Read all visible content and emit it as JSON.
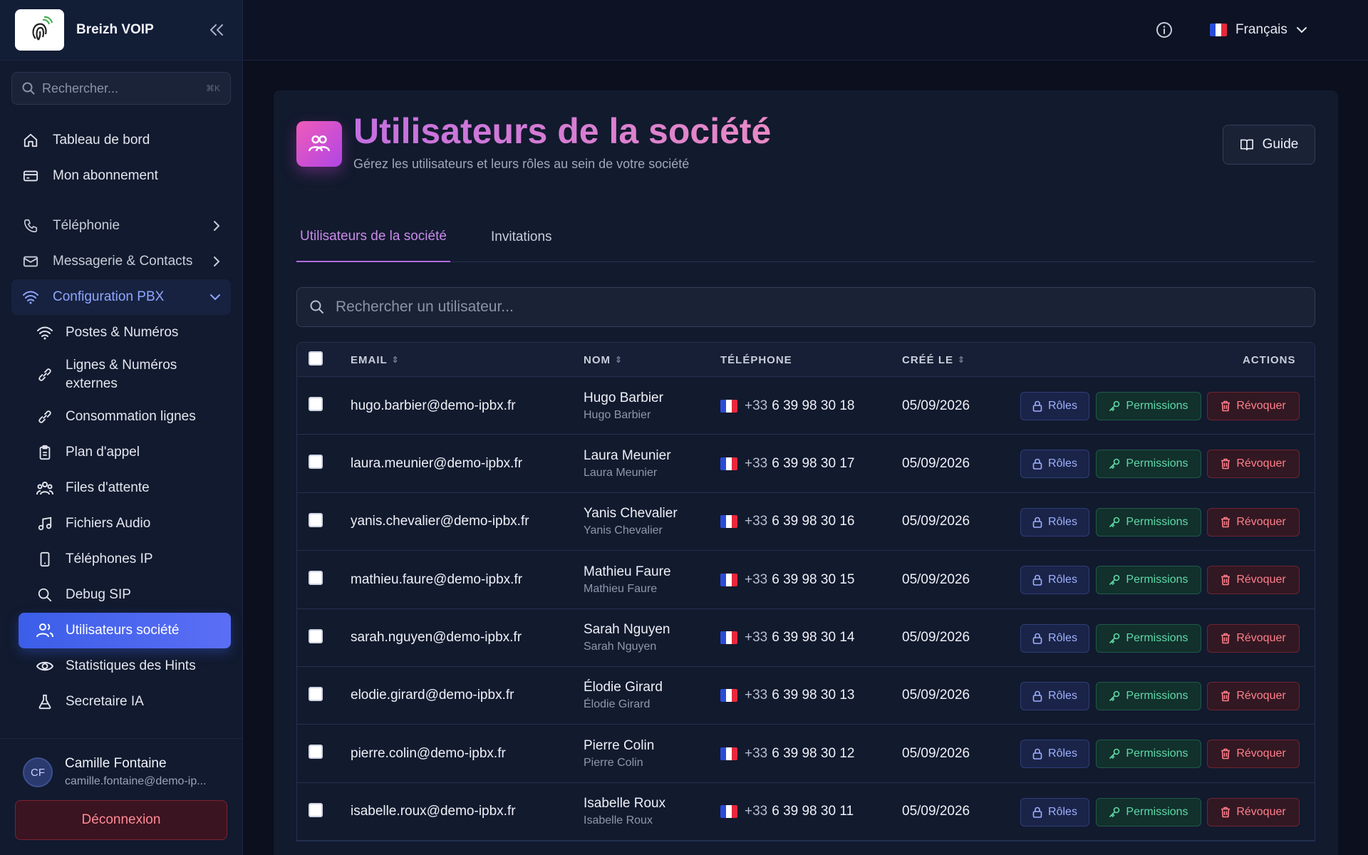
{
  "brand": {
    "name": "Breizh VOIP"
  },
  "sidebar": {
    "search_placeholder": "Rechercher...",
    "search_shortcut": "⌘K",
    "items": [
      {
        "label": "Tableau de bord",
        "icon": "home-icon"
      },
      {
        "label": "Mon abonnement",
        "icon": "credit-card-icon"
      },
      {
        "label": "Téléphonie",
        "icon": "phone-icon"
      },
      {
        "label": "Messagerie & Contacts",
        "icon": "mail-icon"
      },
      {
        "label": "Configuration PBX",
        "icon": "wifi-icon"
      }
    ],
    "sub_items": [
      {
        "label": "Postes & Numéros",
        "icon": "wifi-icon"
      },
      {
        "label": "Lignes & Numéros externes",
        "icon": "link-icon"
      },
      {
        "label": "Consommation lignes",
        "icon": "link-icon"
      },
      {
        "label": "Plan d'appel",
        "icon": "clipboard-icon"
      },
      {
        "label": "Files d'attente",
        "icon": "users-icon"
      },
      {
        "label": "Fichiers Audio",
        "icon": "music-icon"
      },
      {
        "label": "Téléphones IP",
        "icon": "smartphone-icon"
      },
      {
        "label": "Debug SIP",
        "icon": "search-icon"
      },
      {
        "label": "Utilisateurs société",
        "icon": "users-icon"
      },
      {
        "label": "Statistiques des Hints",
        "icon": "eye-icon"
      },
      {
        "label": "Secretaire IA",
        "icon": "flask-icon"
      }
    ],
    "user": {
      "initials": "CF",
      "name": "Camille Fontaine",
      "email": "camille.fontaine@demo-ip..."
    },
    "logout_label": "Déconnexion"
  },
  "topbar": {
    "language": "Français"
  },
  "page": {
    "title": "Utilisateurs de la société",
    "subtitle": "Gérez les utilisateurs et leurs rôles au sein de votre société",
    "guide_label": "Guide",
    "tabs": [
      "Utilisateurs de la société",
      "Invitations"
    ],
    "search_placeholder": "Rechercher un utilisateur..."
  },
  "table": {
    "headers": {
      "email": "EMAIL",
      "name": "NOM",
      "phone": "TÉLÉPHONE",
      "created": "CRÉÉ LE",
      "actions": "ACTIONS"
    },
    "action_labels": {
      "roles": "Rôles",
      "permissions": "Permissions",
      "revoke": "Révoquer"
    },
    "rows": [
      {
        "email": "hugo.barbier@demo-ipbx.fr",
        "name": "Hugo Barbier",
        "subname": "Hugo Barbier",
        "prefix": "+33",
        "phone": "6 39 98 30 18",
        "created": "05/09/2026"
      },
      {
        "email": "laura.meunier@demo-ipbx.fr",
        "name": "Laura Meunier",
        "subname": "Laura Meunier",
        "prefix": "+33",
        "phone": "6 39 98 30 17",
        "created": "05/09/2026"
      },
      {
        "email": "yanis.chevalier@demo-ipbx.fr",
        "name": "Yanis Chevalier",
        "subname": "Yanis Chevalier",
        "prefix": "+33",
        "phone": "6 39 98 30 16",
        "created": "05/09/2026"
      },
      {
        "email": "mathieu.faure@demo-ipbx.fr",
        "name": "Mathieu Faure",
        "subname": "Mathieu Faure",
        "prefix": "+33",
        "phone": "6 39 98 30 15",
        "created": "05/09/2026"
      },
      {
        "email": "sarah.nguyen@demo-ipbx.fr",
        "name": "Sarah Nguyen",
        "subname": "Sarah Nguyen",
        "prefix": "+33",
        "phone": "6 39 98 30 14",
        "created": "05/09/2026"
      },
      {
        "email": "elodie.girard@demo-ipbx.fr",
        "name": "Élodie Girard",
        "subname": "Élodie Girard",
        "prefix": "+33",
        "phone": "6 39 98 30 13",
        "created": "05/09/2026"
      },
      {
        "email": "pierre.colin@demo-ipbx.fr",
        "name": "Pierre Colin",
        "subname": "Pierre Colin",
        "prefix": "+33",
        "phone": "6 39 98 30 12",
        "created": "05/09/2026"
      },
      {
        "email": "isabelle.roux@demo-ipbx.fr",
        "name": "Isabelle Roux",
        "subname": "Isabelle Roux",
        "prefix": "+33",
        "phone": "6 39 98 30 11",
        "created": "05/09/2026"
      }
    ]
  },
  "colors": {
    "accent": "#4a66f0",
    "title_gradient_start": "#c36fe0",
    "danger": "#ff7f8b",
    "success": "#5fd9a8"
  }
}
